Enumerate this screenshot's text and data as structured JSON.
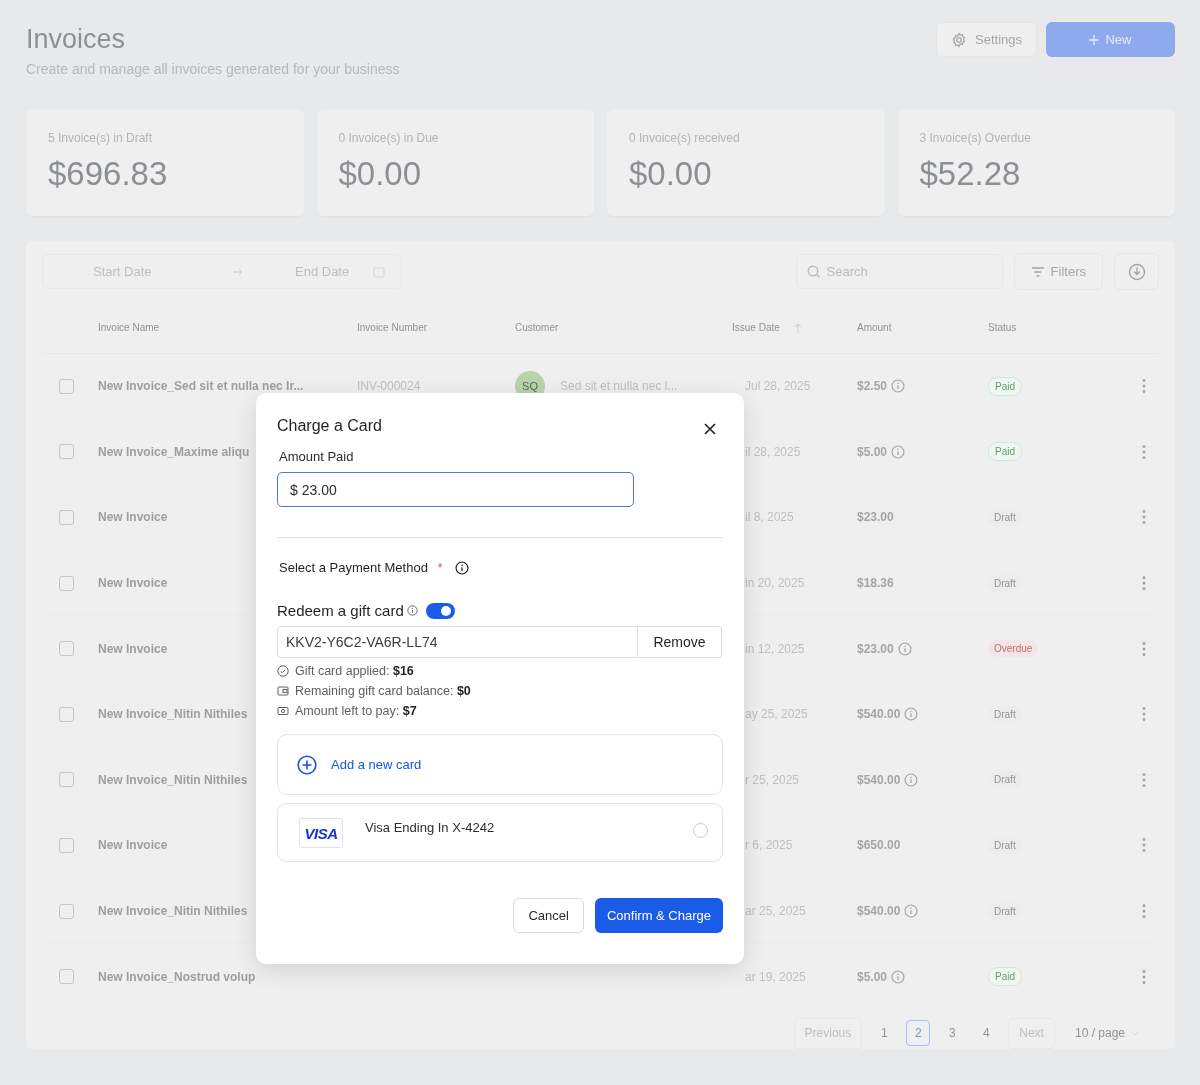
{
  "header": {
    "title": "Invoices",
    "subtitle": "Create and manage all invoices generated for your business",
    "settings_button": "Settings",
    "new_button": "New"
  },
  "stats": [
    {
      "label": "5 Invoice(s) in Draft",
      "value": "$696.83"
    },
    {
      "label": "0 Invoice(s) in Due",
      "value": "$0.00"
    },
    {
      "label": "0 Invoice(s) received",
      "value": "$0.00"
    },
    {
      "label": "3 Invoice(s) Overdue",
      "value": "$52.28"
    }
  ],
  "toolbar": {
    "start_date": "Start Date",
    "end_date": "End Date",
    "search_placeholder": "Search",
    "filters_button": "Filters"
  },
  "table": {
    "columns": [
      {
        "label": "Invoice Name",
        "sorted": false
      },
      {
        "label": "Invoice Number",
        "sorted": false
      },
      {
        "label": "Customer",
        "sorted": false
      },
      {
        "label": "Issue Date",
        "sorted": true
      },
      {
        "label": "Amount",
        "sorted": false
      },
      {
        "label": "Status",
        "sorted": false
      }
    ],
    "rows": [
      {
        "checked": false,
        "name": "New Invoice_Sed sit et nulla nec Ir...",
        "number": "INV-000024",
        "avatar": "SQ",
        "customer": "Sed sit et nulla nec l...",
        "date": "Jul 28, 2025",
        "amount": "$2.50",
        "info_icon": true,
        "status": "Paid",
        "kind": "paid"
      },
      {
        "checked": false,
        "name": "New Invoice_Maxime aliqu",
        "date": "il 28, 2025",
        "amount": "$5.00",
        "info_icon": true,
        "status": "Paid",
        "kind": "paid"
      },
      {
        "checked": false,
        "name": "New Invoice",
        "date": "il 8, 2025",
        "amount": "$23.00",
        "info_icon": false,
        "status": "Draft",
        "kind": "draft"
      },
      {
        "checked": false,
        "name": "New Invoice",
        "date": "in 20, 2025",
        "amount": "$18.36",
        "info_icon": false,
        "status": "Draft",
        "kind": "draft"
      },
      {
        "checked": false,
        "name": "New Invoice",
        "date": "in 12, 2025",
        "amount": "$23.00",
        "info_icon": true,
        "status": "Overdue",
        "kind": "overdue"
      },
      {
        "checked": false,
        "name": "New Invoice_Nitin Nithiles",
        "date": "ay 25, 2025",
        "amount": "$540.00",
        "info_icon": true,
        "status": "Draft",
        "kind": "draft"
      },
      {
        "checked": false,
        "name": "New Invoice_Nitin Nithiles",
        "date": "r 25, 2025",
        "amount": "$540.00",
        "info_icon": true,
        "status": "Draft",
        "kind": "draft"
      },
      {
        "checked": false,
        "name": "New Invoice",
        "date": "r 6, 2025",
        "amount": "$650.00",
        "info_icon": false,
        "status": "Draft",
        "kind": "draft"
      },
      {
        "checked": false,
        "name": "New Invoice_Nitin Nithiles",
        "date": "ar 25, 2025",
        "amount": "$540.00",
        "info_icon": true,
        "status": "Draft",
        "kind": "draft"
      },
      {
        "checked": false,
        "name": "New Invoice_Nostrud volup",
        "date": "ar 19, 2025",
        "amount": "$5.00",
        "info_icon": true,
        "status": "Paid",
        "kind": "paid"
      }
    ]
  },
  "pagination": {
    "previous": "Previous",
    "pages": [
      {
        "label": "1",
        "selected": false
      },
      {
        "label": "2",
        "selected": true
      },
      {
        "label": "3",
        "selected": false
      },
      {
        "label": "4",
        "selected": false
      }
    ],
    "next": "Next",
    "page_size": "10 / page"
  },
  "dialog": {
    "title": "Charge a Card",
    "amount_label": "Amount Paid",
    "amount_value": "$ 23.00",
    "payment_label": "Select a Payment Method",
    "required_mark": "*",
    "gift_label": "Redeem a gift card",
    "gift_on": true,
    "gift_code": "KKV2-Y6C2-VA6R-LL74",
    "remove_button": "Remove",
    "summary": [
      {
        "kind": "check",
        "text": "Gift card applied: **$16**"
      },
      {
        "kind": "wallet",
        "text": "Remaining gift card balance: **$0**"
      },
      {
        "kind": "cash",
        "text": "Amount left to pay: **$7**"
      }
    ],
    "add_card": "Add a new card",
    "cards": [
      {
        "logo": "VISA",
        "label": "Visa Ending In X-4242",
        "selected": false
      }
    ],
    "cancel_button": "Cancel",
    "confirm_button": "Confirm & Charge"
  }
}
